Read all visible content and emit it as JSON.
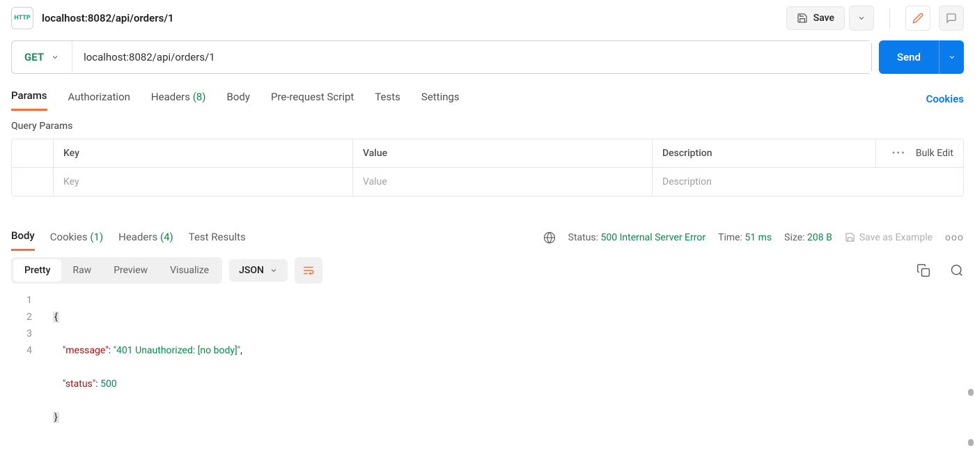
{
  "tab": {
    "title": "localhost:8082/api/orders/1"
  },
  "toolbar": {
    "save": "Save"
  },
  "request": {
    "method": "GET",
    "url": "localhost:8082/api/orders/1",
    "send": "Send"
  },
  "reqTabs": {
    "params": "Params",
    "authorization": "Authorization",
    "headers": "Headers",
    "headersCount": "(8)",
    "body": "Body",
    "prerequest": "Pre-request Script",
    "tests": "Tests",
    "settings": "Settings",
    "cookies": "Cookies"
  },
  "queryParams": {
    "title": "Query Params",
    "keyHead": "Key",
    "valHead": "Value",
    "descHead": "Description",
    "bulkEdit": "Bulk Edit",
    "keyPh": "Key",
    "valPh": "Value",
    "descPh": "Description",
    "dots": "•••"
  },
  "respTabs": {
    "body": "Body",
    "cookies": "Cookies",
    "cookiesCount": "(1)",
    "headers": "Headers",
    "headersCount": "(4)",
    "testResults": "Test Results"
  },
  "respMeta": {
    "statusLabel": "Status:",
    "statusVal": "500 Internal Server Error",
    "timeLabel": "Time:",
    "timeVal": "51 ms",
    "sizeLabel": "Size:",
    "sizeVal": "208 B",
    "saveExample": "Save as Example",
    "more": "ooo"
  },
  "viewTabs": {
    "pretty": "Pretty",
    "raw": "Raw",
    "preview": "Preview",
    "visualize": "Visualize",
    "type": "JSON"
  },
  "responseBody": {
    "line1_open": "{",
    "line2_key": "\"message\"",
    "line2_sep": ": ",
    "line2_val": "\"401 Unauthorized: [no body]\"",
    "line2_end": ",",
    "line3_key": "\"status\"",
    "line3_sep": ": ",
    "line3_val": "500",
    "line4_close": "}",
    "ln1": "1",
    "ln2": "2",
    "ln3": "3",
    "ln4": "4"
  }
}
